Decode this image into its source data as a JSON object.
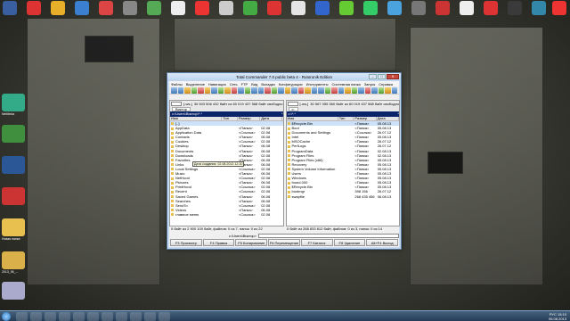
{
  "window": {
    "title": "Total Commander 7.0 public beta 4 - Rutoronik Edition",
    "buttons": {
      "minimize": "–",
      "maximize": "□",
      "close": "✕"
    }
  },
  "menu": [
    "Файлы",
    "Выделение",
    "Навигация",
    "Сеть",
    "FTP",
    "Вид",
    "Вкладки",
    "Конфигурация",
    "Инструменты",
    "Системная папка",
    "Запуск",
    "Справка"
  ],
  "left_panel": {
    "drive": "[-ws-]",
    "free_info": "30 503 506 432 байт из 60 019 437 568 байт свободно",
    "tab": "Виктор",
    "path": "c:\\Users\\Виктор\\*.*",
    "columns": [
      "Имя",
      "Тип",
      "Размер",
      "Дата"
    ],
    "rows": [
      [
        "[..]",
        "",
        "",
        ""
      ],
      [
        "AppData",
        "",
        "<Папка>",
        "02.08"
      ],
      [
        "Application Data",
        "",
        "<Ссылка>",
        "02.08"
      ],
      [
        "Contacts",
        "",
        "<Папка>",
        "06.08"
      ],
      [
        "Cookies",
        "",
        "<Ссылка>",
        "02.08"
      ],
      [
        "Desktop",
        "",
        "<Папка>",
        "06.08"
      ],
      [
        "Documents",
        "",
        "<Папка>",
        "06.08"
      ],
      [
        "Downloads",
        "",
        "<Папка>",
        "02.08"
      ],
      [
        "Favorites",
        "",
        "<Папка>",
        "06.08"
      ],
      [
        "Links",
        "",
        "<Папка>",
        "06.08"
      ],
      [
        "Local Settings",
        "",
        "<Ссылка>",
        "02.08"
      ],
      [
        "Music",
        "",
        "<Папка>",
        "06.08"
      ],
      [
        "NetHood",
        "",
        "<Ссылка>",
        "02.08"
      ],
      [
        "Pictures",
        "",
        "<Папка>",
        "06.08"
      ],
      [
        "PrintHood",
        "",
        "<Ссылка>",
        "02.08"
      ],
      [
        "Recent",
        "",
        "<Ссылка>",
        "02.08"
      ],
      [
        "Saved Games",
        "",
        "<Папка>",
        "06.08"
      ],
      [
        "Searches",
        "",
        "<Папка>",
        "06.08"
      ],
      [
        "SendTo",
        "",
        "<Ссылка>",
        "02.08"
      ],
      [
        "Videos",
        "",
        "<Папка>",
        "06.08"
      ],
      [
        "главное меню",
        "",
        "<Ссылка>",
        "02.08"
      ]
    ],
    "tooltip": "Дата создания: 02.08.2013 12:10",
    "status": "0 байт из 2 900 100 байт, файлов: 0 из 7, папок: 0 из 22"
  },
  "right_panel": {
    "drive": "[-ws-]",
    "free_info": "30 567 055 360 байт из 60 019 437 568 байт свободно",
    "tab": "c:",
    "path": "c:\\*.*",
    "columns": [
      "Имя",
      "Тип",
      "Размер",
      "Дата"
    ],
    "rows": [
      [
        "$Recycle.Bin",
        "",
        "<Папка>",
        "05.08.13"
      ],
      [
        "Boot",
        "",
        "<Папка>",
        "05.08.13"
      ],
      [
        "Documents and Settings",
        "",
        "<Ссылка>",
        "26.07.12"
      ],
      [
        "Intel",
        "",
        "<Папка>",
        "05.08.13"
      ],
      [
        "MSOCache",
        "",
        "<Папка>",
        "26.07.12"
      ],
      [
        "PerfLogs",
        "",
        "<Папка>",
        "26.07.12"
      ],
      [
        "ProgramData",
        "",
        "<Папка>",
        "02.08.13"
      ],
      [
        "Program Files",
        "",
        "<Папка>",
        "02.08.13"
      ],
      [
        "Program Files (x86)",
        "",
        "<Папка>",
        "05.08.13"
      ],
      [
        "Recovery",
        "",
        "<Папка>",
        "05.08.13"
      ],
      [
        "System Volume Information",
        "",
        "<Папка>",
        "05.08.13"
      ],
      [
        "Users",
        "",
        "<Папка>",
        "05.08.13"
      ],
      [
        "Windows",
        "",
        "<Папка>",
        "05.08.13"
      ],
      [
        "found.000",
        "",
        "<Папка>",
        "05.08.13"
      ],
      [
        "$Recycle.Bin",
        "",
        "<Папка>",
        "05.08.13"
      ],
      [
        "bootmgr",
        "",
        "398 156",
        "26.07.12"
      ],
      [
        "swapfile",
        "",
        "268 435 456",
        "06.08.13"
      ]
    ],
    "status": "0 байт из 268 833 612 байт, файлов: 0 из 3, папок: 0 из 14"
  },
  "cmdline_label": "c:\\Users\\Виктор>",
  "fkeys": [
    "F3 Просмотр",
    "F4 Правка",
    "F5 Копирование",
    "F6 Перемещение",
    "F7 Каталог",
    "F8 Удаление",
    "Alt+F4 Выход"
  ],
  "tray": {
    "lang": "РУС",
    "time": "15:10",
    "date": "06.08.2013"
  },
  "desktop_icons": [
    "NetMeda",
    "Новая папка",
    "2013_06_..."
  ]
}
